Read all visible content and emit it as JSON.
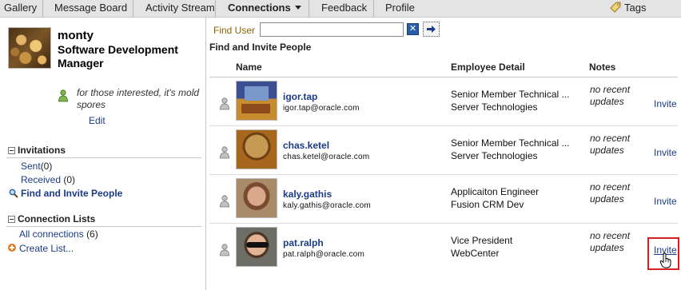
{
  "nav": {
    "tabs": [
      "Gallery",
      "Message Board",
      "Activity Stream",
      "Connections",
      "Feedback",
      "Profile"
    ],
    "tags_label": "Tags"
  },
  "profile": {
    "name": "monty",
    "title": "Software Development Manager",
    "status": "for those interested, it's mold spores",
    "edit_label": "Edit"
  },
  "invitations": {
    "heading": "Invitations",
    "sent_label": "Sent",
    "sent_count": "(0)",
    "received_label": "Received",
    "received_count": "(0)",
    "find_label": "Find and Invite People"
  },
  "connection_lists": {
    "heading": "Connection Lists",
    "all_label": "All connections",
    "all_count": "(6)",
    "create_label": "Create List..."
  },
  "search": {
    "label": "Find User",
    "value": "",
    "clear_icon": "close-icon",
    "go_icon": "arrow-right-icon"
  },
  "main": {
    "section_title": "Find and Invite People",
    "columns": [
      "Name",
      "Employee Detail",
      "Notes"
    ],
    "people": [
      {
        "name": "igor.tap",
        "email": "igor.tap@oracle.com",
        "detail1": "Senior Member Technical ...",
        "detail2": "Server Technologies",
        "notes": "no recent updates",
        "action": "Invite"
      },
      {
        "name": "chas.ketel",
        "email": "chas.ketel@oracle.com",
        "detail1": "Senior Member Technical ...",
        "detail2": "Server Technologies",
        "notes": "no recent updates",
        "action": "Invite"
      },
      {
        "name": "kaly.gathis",
        "email": "kaly.gathis@oracle.com",
        "detail1": "Applicaiton Engineer",
        "detail2": "Fusion CRM Dev",
        "notes": "no recent updates",
        "action": "Invite"
      },
      {
        "name": "pat.ralph",
        "email": "pat.ralph@oracle.com",
        "detail1": "Vice President",
        "detail2": "WebCenter",
        "notes": "no recent updates",
        "action": "Invite"
      }
    ]
  },
  "colors": {
    "link": "#1b3b86",
    "highlight": "#d42020",
    "find_label": "#8a6300"
  }
}
